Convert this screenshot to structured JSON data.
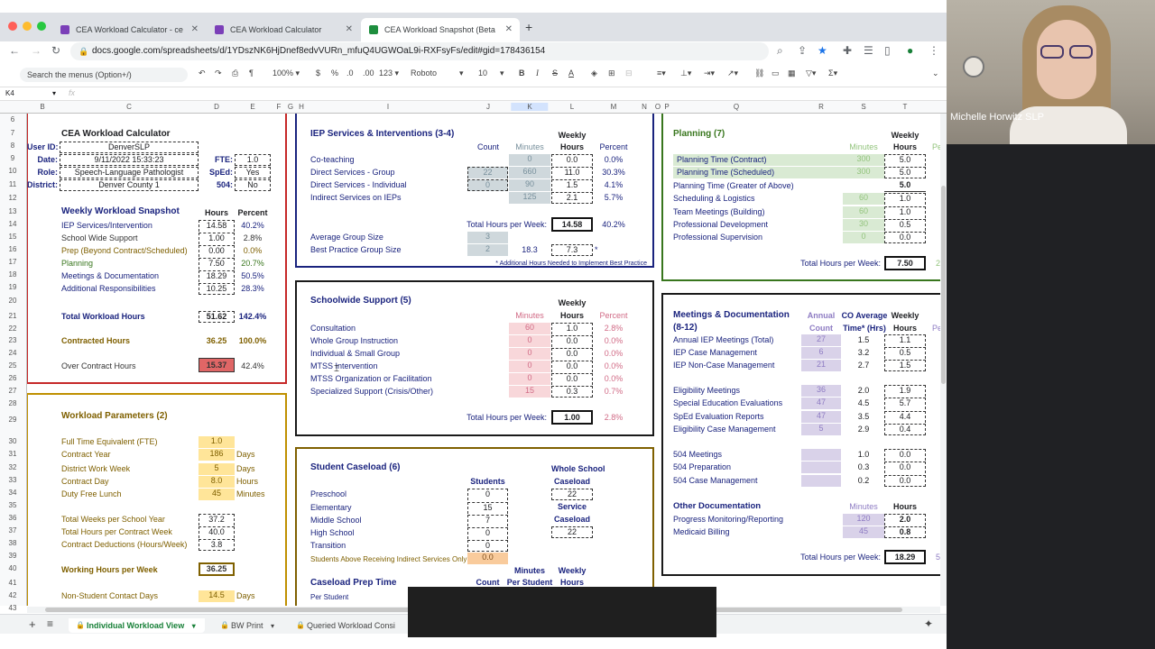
{
  "browser": {
    "tabs": [
      {
        "title": "CEA Workload Calculator - ce",
        "active": false
      },
      {
        "title": "CEA Workload Calculator",
        "active": false
      },
      {
        "title": "CEA Workload Snapshot (Beta",
        "active": true
      }
    ],
    "url": "docs.google.com/spreadsheets/d/1YDszNK6HjDnef8edvVURn_mfuQ4UGWOaL9i-RXFsyFs/edit#gid=178436154"
  },
  "toolbar": {
    "menu_search": "Search the menus (Option+/)",
    "zoom": "100%",
    "currency": "$",
    "percent": "%",
    "dec_decrease": ".0",
    "dec_increase": ".00",
    "format": "123",
    "font": "Roboto",
    "font_size": "10",
    "bold": "B",
    "italic": "I",
    "strike": "S",
    "text_color": "A"
  },
  "formula_bar": {
    "cell_ref": "K4",
    "fx": "fx"
  },
  "columns": [
    "B",
    "C",
    "D",
    "E",
    "F",
    "G",
    "H",
    "I",
    "J",
    "K",
    "L",
    "M",
    "N",
    "O",
    "P",
    "Q",
    "R",
    "S",
    "T"
  ],
  "rows": [
    "6",
    "7",
    "8",
    "9",
    "10",
    "11",
    "12",
    "13",
    "14",
    "15",
    "16",
    "17",
    "18",
    "19",
    "20",
    "21",
    "22",
    "23",
    "24",
    "25",
    "26",
    "27",
    "28",
    "29",
    "30",
    "31",
    "32",
    "33",
    "34",
    "35",
    "36",
    "37",
    "38",
    "39",
    "40",
    "41",
    "42",
    "43"
  ],
  "calc": {
    "title": "CEA Workload Calculator",
    "user_id_label": "User ID:",
    "user_id": "DenverSLP",
    "date_label": "Date:",
    "date": "9/11/2022 15:33:23",
    "role_label": "Role:",
    "role": "Speech-Language Pathologist",
    "district_label": "District:",
    "district": "Denver County 1",
    "fte_label": "FTE:",
    "fte": "1.0",
    "sped_label": "SpEd:",
    "sped": "Yes",
    "l504_label": "504:",
    "l504": "No"
  },
  "snapshot": {
    "title": "Weekly Workload Snapshot",
    "col_hours": "Hours",
    "col_percent": "Percent",
    "rows": [
      {
        "label": "IEP Services/Intervention",
        "hours": "14.58",
        "percent": "40.2%"
      },
      {
        "label": "School Wide Support",
        "hours": "1.00",
        "percent": "2.8%"
      },
      {
        "label": "Prep (Beyond Contract/Scheduled)",
        "hours": "0.00",
        "percent": "0.0%"
      },
      {
        "label": "Planning",
        "hours": "7.50",
        "percent": "20.7%"
      },
      {
        "label": "Meetings & Documentation",
        "hours": "18.29",
        "percent": "50.5%"
      },
      {
        "label": "Additional Responsibilities",
        "hours": "10.25",
        "percent": "28.3%"
      }
    ],
    "total_label": "Total Workload Hours",
    "total_hours": "51.62",
    "total_percent": "142.4%",
    "contracted_label": "Contracted Hours",
    "contracted_hours": "36.25",
    "contracted_percent": "100.0%",
    "over_label": "Over Contract Hours",
    "over_hours": "15.37",
    "over_percent": "42.4%"
  },
  "params": {
    "title": "Workload Parameters (2)",
    "rows": [
      {
        "label": "Full Time Equivalent (FTE)",
        "value": "1.0",
        "unit": ""
      },
      {
        "label": "Contract Year",
        "value": "186",
        "unit": "Days"
      },
      {
        "label": "District Work Week",
        "value": "5",
        "unit": "Days"
      },
      {
        "label": "Contract Day",
        "value": "8.0",
        "unit": "Hours"
      },
      {
        "label": "Duty Free Lunch",
        "value": "45",
        "unit": "Minutes"
      }
    ],
    "calc_rows": [
      {
        "label": "Total Weeks per School Year",
        "value": "37.2"
      },
      {
        "label": "Total Hours per Contract Week",
        "value": "40.0"
      },
      {
        "label": "Contract Deductions (Hours/Week)",
        "value": "3.8"
      }
    ],
    "working_label": "Working Hours per Week",
    "working_value": "36.25",
    "nonstudent_label": "Non-Student Contact Days",
    "nonstudent_value": "14.5",
    "nonstudent_unit": "Days"
  },
  "iep": {
    "title": "IEP Services & Interventions (3-4)",
    "h_count": "Count",
    "h_minutes": "Minutes",
    "h_weekly": "Weekly",
    "h_hours": "Hours",
    "h_percent": "Percent",
    "rows": [
      {
        "label": "Co-teaching",
        "count": "",
        "minutes": "0",
        "hours": "0.0",
        "percent": "0.0%"
      },
      {
        "label": "Direct Services - Group",
        "count": "22",
        "minutes": "660",
        "hours": "11.0",
        "percent": "30.3%"
      },
      {
        "label": "Direct Services - Individual",
        "count": "0",
        "minutes": "90",
        "hours": "1.5",
        "percent": "4.1%"
      },
      {
        "label": "Indirect Services on IEPs",
        "count": "",
        "minutes": "125",
        "hours": "2.1",
        "percent": "5.7%"
      }
    ],
    "total_label": "Total Hours per Week:",
    "total": "14.58",
    "total_percent": "40.2%",
    "avg_group_label": "Average Group Size",
    "avg_group": "3",
    "best_group_label": "Best Practice Group Size",
    "best_group": "2",
    "best_minutes": "18.3",
    "best_hours": "7.3",
    "best_star": "*",
    "footnote": "* Additional Hours Needed to Implement Best Practice"
  },
  "schoolwide": {
    "title": "Schoolwide Support (5)",
    "h_weekly": "Weekly",
    "h_minutes": "Minutes",
    "h_hours": "Hours",
    "h_percent": "Percent",
    "rows": [
      {
        "label": "Consultation",
        "minutes": "60",
        "hours": "1.0",
        "percent": "2.8%"
      },
      {
        "label": "Whole Group Instruction",
        "minutes": "0",
        "hours": "0.0",
        "percent": "0.0%"
      },
      {
        "label": "Individual & Small Group",
        "minutes": "0",
        "hours": "0.0",
        "percent": "0.0%"
      },
      {
        "label": "MTSS Intervention",
        "minutes": "0",
        "hours": "0.0",
        "percent": "0.0%"
      },
      {
        "label": "MTSS Organization or Facilitation",
        "minutes": "0",
        "hours": "0.0",
        "percent": "0.0%"
      },
      {
        "label": "Specialized Support (Crisis/Other)",
        "minutes": "15",
        "hours": "0.3",
        "percent": "0.7%"
      }
    ],
    "total_label": "Total Hours per Week:",
    "total": "1.00",
    "total_percent": "2.8%"
  },
  "caseload": {
    "title": "Student Caseload (6)",
    "h_students": "Students",
    "h_whole": "Whole School",
    "h_caseload": "Caseload",
    "h_service": "Service",
    "h_caseload2": "Caseload",
    "whole_value": "22",
    "service_value": "22",
    "rows": [
      {
        "label": "Preschool",
        "value": "0"
      },
      {
        "label": "Elementary",
        "value": "15"
      },
      {
        "label": "Middle School",
        "value": "7"
      },
      {
        "label": "High School",
        "value": "0"
      },
      {
        "label": "Transition",
        "value": "0"
      }
    ],
    "indirect_label": "Students Above Receiving Indirect Services Only",
    "indirect_value": "0.0",
    "prep_title": "Caseload Prep Time",
    "prep_h_count": "Count",
    "prep_h_minutes": "Minutes",
    "prep_h_per_student": "Per Student",
    "prep_h_weekly": "Weekly",
    "prep_h_hours": "Hours",
    "prep_per_student": "Per Student"
  },
  "planning": {
    "title": "Planning (7)",
    "h_weekly": "Weekly",
    "h_minutes": "Minutes",
    "h_hours": "Hours",
    "h_pe": "Pe",
    "rows": [
      {
        "label": "Planning Time (Contract)",
        "minutes": "300",
        "hours": "5.0"
      },
      {
        "label": "Planning Time (Scheduled)",
        "minutes": "300",
        "hours": "5.0"
      },
      {
        "label": "Planning Time (Greater of Above)",
        "minutes": "",
        "hours": "5.0"
      },
      {
        "label": "Scheduling & Logistics",
        "minutes": "60",
        "hours": "1.0"
      },
      {
        "label": "Team Meetings (Building)",
        "minutes": "60",
        "hours": "1.0"
      },
      {
        "label": "Professional Development",
        "minutes": "30",
        "hours": "0.5"
      },
      {
        "label": "Professional Supervision",
        "minutes": "0",
        "hours": "0.0"
      }
    ],
    "total_label": "Total Hours per Week:",
    "total": "7.50",
    "total_pct_partial": "2"
  },
  "meetings": {
    "title": "Meetings & Documentation",
    "title2": "(8-12)",
    "h_annual": "Annual",
    "h_count": "Count",
    "h_co_avg": "CO Average",
    "h_time": "Time* (Hrs)",
    "h_weekly": "Weekly",
    "h_hours": "Hours",
    "h_pe": "Pe",
    "rows": [
      {
        "label": "Annual IEP Meetings (Total)",
        "count": "27",
        "time": "1.5",
        "hours": "1.1"
      },
      {
        "label": "IEP Case Management",
        "count": "6",
        "time": "3.2",
        "hours": "0.5"
      },
      {
        "label": "IEP Non-Case Management",
        "count": "21",
        "time": "2.7",
        "hours": "1.5"
      },
      {
        "label": "Eligibility Meetings",
        "count": "36",
        "time": "2.0",
        "hours": "1.9"
      },
      {
        "label": "Special Education Evaluations",
        "count": "47",
        "time": "4.5",
        "hours": "5.7"
      },
      {
        "label": "SpEd Evaluation Reports",
        "count": "47",
        "time": "3.5",
        "hours": "4.4"
      },
      {
        "label": "Eligibility Case Management",
        "count": "5",
        "time": "2.9",
        "hours": "0.4"
      },
      {
        "label": "504 Meetings",
        "count": "",
        "time": "1.0",
        "hours": "0.0"
      },
      {
        "label": "504 Preparation",
        "count": "",
        "time": "0.3",
        "hours": "0.0"
      },
      {
        "label": "504 Case Management",
        "count": "",
        "time": "0.2",
        "hours": "0.0"
      }
    ],
    "other_title": "Other Documentation",
    "other_h_minutes": "Minutes",
    "other_h_hours": "Hours",
    "other_rows": [
      {
        "label": "Progress Monitoring/Reporting",
        "minutes": "120",
        "hours": "2.0"
      },
      {
        "label": "Medicaid Billing",
        "minutes": "45",
        "hours": "0.8"
      }
    ],
    "total_label": "Total Hours per Week:",
    "total": "18.29",
    "total_pct_partial": "5"
  },
  "sheet_tabs": {
    "add": "+",
    "list": "≡",
    "tabs": [
      {
        "label": "Individual Workload View",
        "active": true
      },
      {
        "label": "BW Print",
        "active": false
      },
      {
        "label": "Queried Workload Consi",
        "active": false
      }
    ]
  },
  "webcam": {
    "name": "Michelle Horwitz SLP"
  },
  "colors": {
    "accent_green": "#188038",
    "section_red": "#c62828",
    "section_yellow": "#bf9000",
    "section_blue": "#1a237e",
    "section_green": "#38761d"
  }
}
